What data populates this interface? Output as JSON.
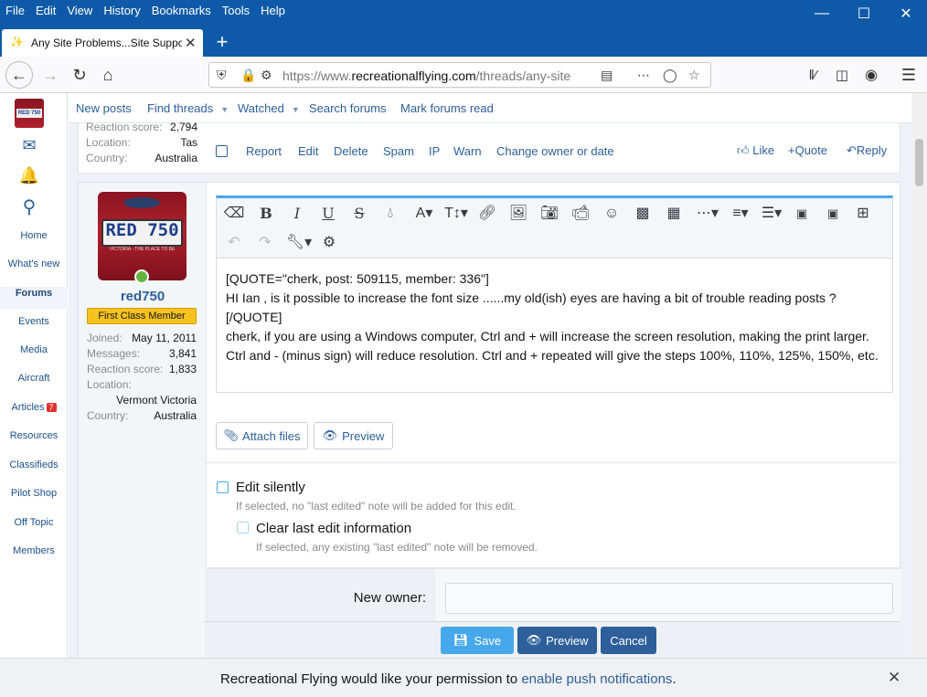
{
  "browser": {
    "menu": [
      "File",
      "Edit",
      "View",
      "History",
      "Bookmarks",
      "Tools",
      "Help"
    ],
    "tab_title": "Any Site Problems...Site Suppor",
    "url_prefix": "https://www.",
    "url_domain": "recreationalflying.com",
    "url_path": "/threads/any-site"
  },
  "sidebar": {
    "items": [
      {
        "label": "Home"
      },
      {
        "label": "What's new"
      },
      {
        "label": "Forums"
      },
      {
        "label": "Events"
      },
      {
        "label": "Media"
      },
      {
        "label": "Aircraft"
      },
      {
        "label": "Articles",
        "badge": "7"
      },
      {
        "label": "Resources"
      },
      {
        "label": "Classifieds"
      },
      {
        "label": "Pilot Shop"
      },
      {
        "label": "Off Topic"
      },
      {
        "label": "Members"
      }
    ]
  },
  "subnav": {
    "items": [
      "New posts",
      "Find threads",
      "Watched",
      "Search forums",
      "Mark forums read"
    ]
  },
  "prev_post": {
    "stats": [
      {
        "label": "Reaction score:",
        "value": "2,794"
      },
      {
        "label": "Location:",
        "value": "Tas"
      },
      {
        "label": "Country:",
        "value": "Australia"
      }
    ],
    "actions": [
      "Report",
      "Edit",
      "Delete",
      "Spam",
      "IP",
      "Warn",
      "Change owner or date"
    ],
    "like": "Like",
    "quote": "+Quote",
    "reply": "Reply"
  },
  "user": {
    "name": "red750",
    "title": "First Class Member",
    "plate": "RED 750",
    "plate_sub": "VICTORIA - THE PLACE TO BE",
    "joined_label": "Joined:",
    "joined": "May 11, 2011",
    "messages_label": "Messages:",
    "messages": "3,841",
    "reaction_label": "Reaction score:",
    "reaction": "1,833",
    "location_label": "Location:",
    "location": "Vermont Victoria",
    "country_label": "Country:",
    "country": "Australia"
  },
  "editor": {
    "lines": [
      "[QUOTE=\"cherk, post: 509115, member: 336\"]",
      "HI Ian , is it possible to increase the font size ......my old(ish) eyes are having a bit of trouble reading posts ?",
      "[/QUOTE]",
      "cherk, if you are using a Windows computer, Ctrl and + will increase the screen resolution, making the print larger. Ctrl and - (minus sign) will reduce resolution. Ctrl and + repeated will give the steps 100%, 110%, 125%, 150%, etc."
    ],
    "attach_label": "Attach files",
    "preview_label": "Preview"
  },
  "options": {
    "edit_silently": "Edit silently",
    "edit_silently_hint": "If selected, no \"last edited\" note will be added for this edit.",
    "clear_last": "Clear last edit information",
    "clear_last_hint": "If selected, any existing \"last edited\" note will be removed.",
    "new_owner_label": "New owner:"
  },
  "submit": {
    "save": "Save",
    "preview": "Preview",
    "cancel": "Cancel"
  },
  "notification": {
    "text": "Recreational Flying would like your permission to ",
    "link": "enable push notifications",
    "suffix": "."
  }
}
